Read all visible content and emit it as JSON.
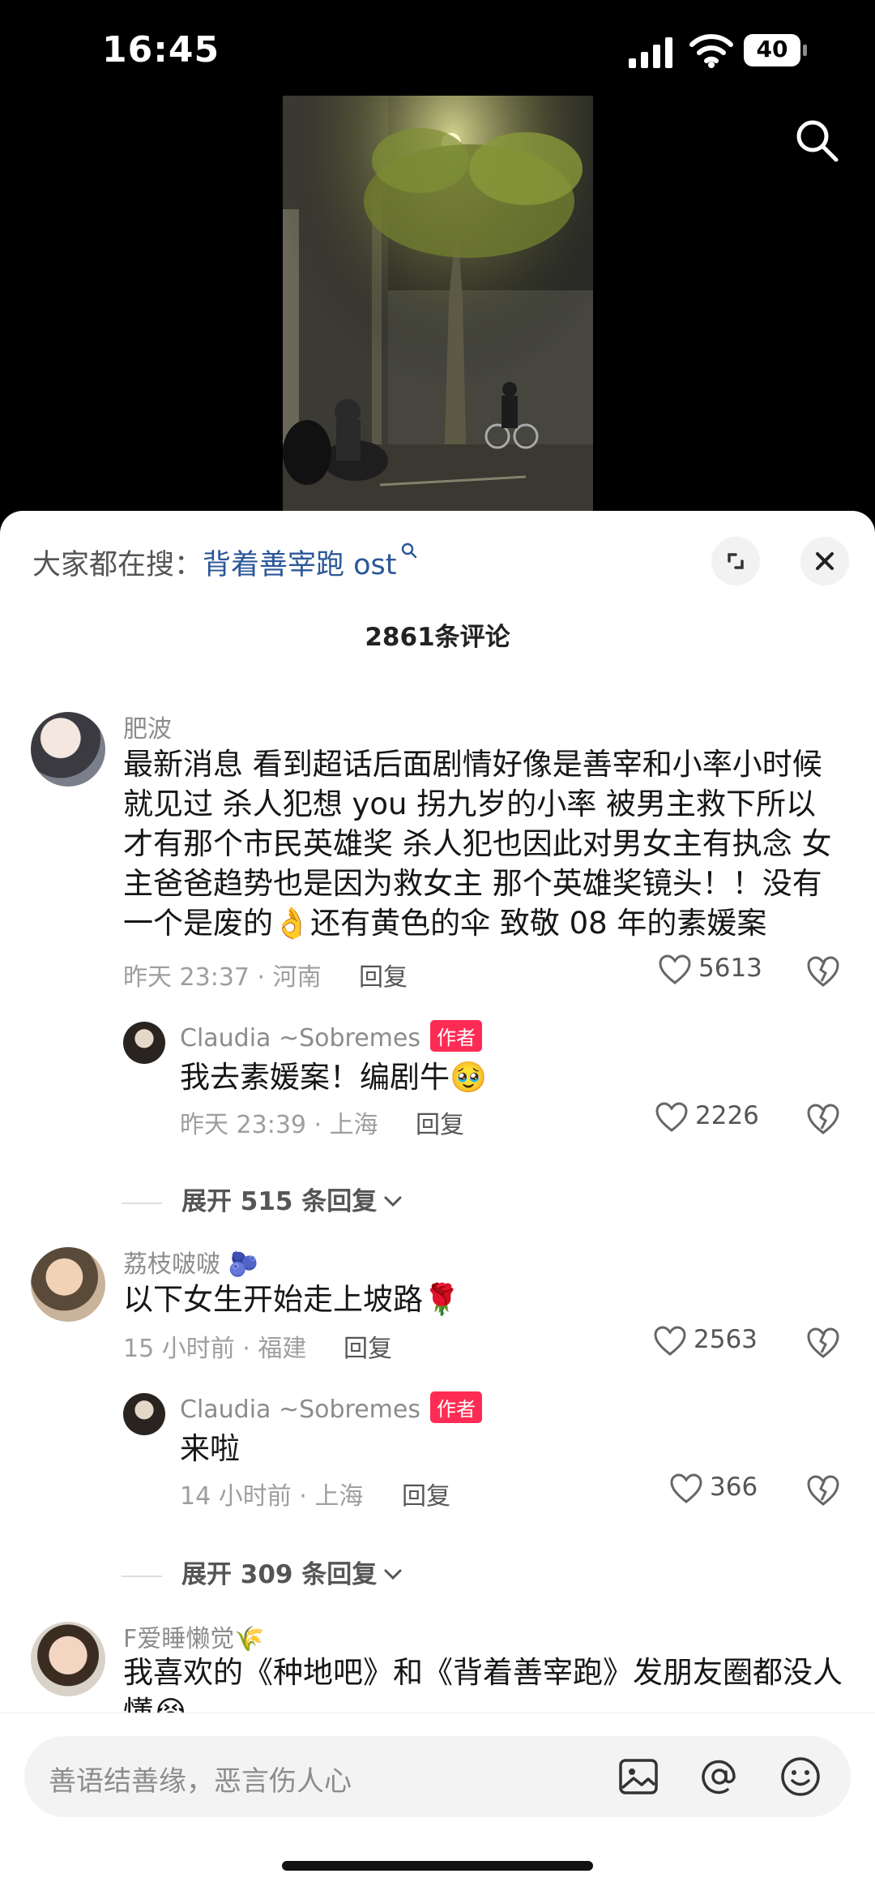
{
  "status_bar": {
    "time": "16:45",
    "battery": "40"
  },
  "trending": {
    "label": "大家都在搜：",
    "term": "背着善宰跑 ost"
  },
  "comment_count": "2861条评论",
  "comments": [
    {
      "username": "肥波",
      "text": "最新消息 看到超话后面剧情好像是善宰和小率小时候就见过 杀人犯想 you 拐九岁的小率 被男主救下所以才有那个市民英雄奖 杀人犯也因此对男女主有执念 女主爸爸趋势也是因为救女主 那个英雄奖镜头！！没有一个是废的👌还有黄色的伞 致敬 08 年的素媛案",
      "meta": "昨天 23:37 · 河南",
      "reply": "回复",
      "likes": "5613",
      "reply_item": {
        "username": "Claudia ~Sobremes",
        "badge": "作者",
        "text": "我去素媛案！编剧牛🥹",
        "meta": "昨天 23:39 · 上海",
        "reply": "回复",
        "likes": "2226"
      },
      "expand": "展开 515 条回复"
    },
    {
      "username": "荔枝啵啵 🫐",
      "text": "以下女生开始走上坡路🌹",
      "meta": "15 小时前 · 福建",
      "reply": "回复",
      "likes": "2563",
      "reply_item": {
        "username": "Claudia ~Sobremes",
        "badge": "作者",
        "text": "来啦",
        "meta": "14 小时前 · 上海",
        "reply": "回复",
        "likes": "366"
      },
      "expand": "展开 309 条回复"
    },
    {
      "username": "F爱睡懒觉🌾",
      "text": "我喜欢的《种地吧》和《背着善宰跑》发朋友圈都没人懂😭"
    }
  ],
  "input": {
    "placeholder": "善语结善缘，恶言伤人心"
  },
  "colors": {
    "accent": "#fe2c55",
    "link": "#2b5797"
  }
}
